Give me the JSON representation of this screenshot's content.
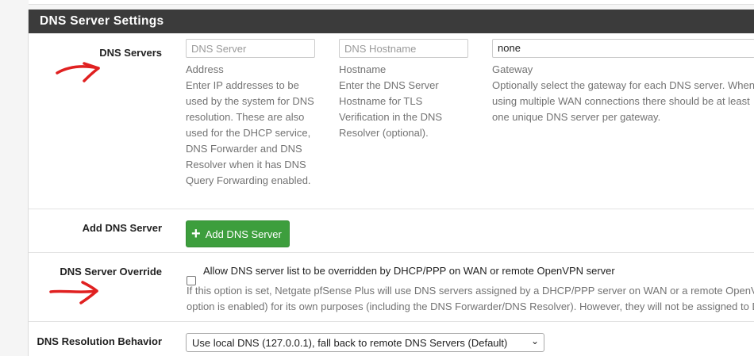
{
  "panel": {
    "title": "DNS Server Settings"
  },
  "dns_servers": {
    "label": "DNS Servers",
    "address": {
      "placeholder": "DNS Server",
      "caption": "Address",
      "help": "Enter IP addresses to be used by the system for DNS resolution. These are also used for the DHCP service, DNS Forwarder and DNS Resolver when it has DNS Query Forwarding enabled."
    },
    "hostname": {
      "placeholder": "DNS Hostname",
      "caption": "Hostname",
      "help": "Enter the DNS Server Hostname for TLS Verification in the DNS Resolver (optional)."
    },
    "gateway": {
      "value": "none",
      "caption": "Gateway",
      "help": "Optionally select the gateway for each DNS server. When using multiple WAN connections there should be at least one unique DNS server per gateway."
    }
  },
  "add_dns_server": {
    "label": "Add DNS Server",
    "button_label": "Add DNS Server"
  },
  "dns_override": {
    "label": "DNS Server Override",
    "checkbox_label": "Allow DNS server list to be overridden by DHCP/PPP on WAN or remote OpenVPN server",
    "checked": false,
    "help_line1": "If this option is set, Netgate pfSense Plus will use DNS servers assigned by a DHCP/PPP server on WAN or a remote OpenVPN server (if the",
    "help_line2": "option is enabled) for its own purposes (including the DNS Forwarder/DNS Resolver). However, they will not be assigned to DHCP clients."
  },
  "dns_resolution": {
    "label": "DNS Resolution Behavior",
    "selected": "Use local DNS (127.0.0.1), fall back to remote DNS Servers (Default)"
  },
  "annotations": {
    "arrow_color": "#e02020"
  }
}
